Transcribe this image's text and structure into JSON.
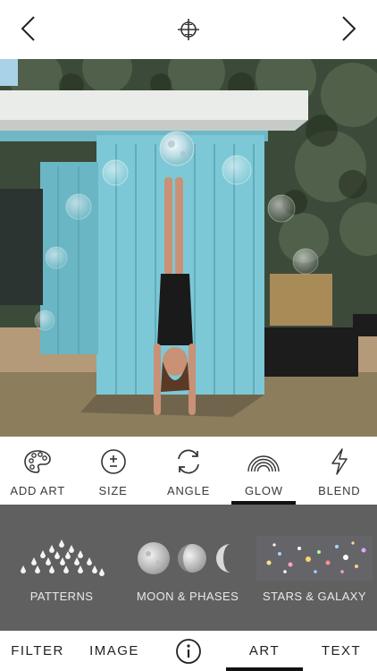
{
  "header": {
    "back_icon": "chevron-left-icon",
    "center_icon": "crosshair-target-icon",
    "forward_icon": "chevron-right-icon"
  },
  "tools": [
    {
      "label": "ADD ART",
      "icon": "palette-icon",
      "active": false
    },
    {
      "label": "SIZE",
      "icon": "plus-minus-icon",
      "active": false
    },
    {
      "label": "ANGLE",
      "icon": "rotate-icon",
      "active": false
    },
    {
      "label": "GLOW",
      "icon": "rainbow-icon",
      "active": true
    },
    {
      "label": "BLEND",
      "icon": "lightning-icon",
      "active": false
    }
  ],
  "art_packs": [
    {
      "label": "PATTERNS",
      "icon": "droplets-pattern-icon"
    },
    {
      "label": "MOON & PHASES",
      "icon": "moon-phases-icon"
    },
    {
      "label": "STARS & GALAXY",
      "icon": "galaxy-icon"
    }
  ],
  "bottom_tabs": [
    {
      "label": "FILTER",
      "active": false
    },
    {
      "label": "IMAGE",
      "active": false
    },
    {
      "label": "",
      "icon": "info-icon",
      "active": false
    },
    {
      "label": "ART",
      "active": true
    },
    {
      "label": "TEXT",
      "active": false
    }
  ],
  "colors": {
    "shed_blue": "#7cc8d6",
    "art_strip_bg": "#606060",
    "active_indicator": "#111111"
  }
}
